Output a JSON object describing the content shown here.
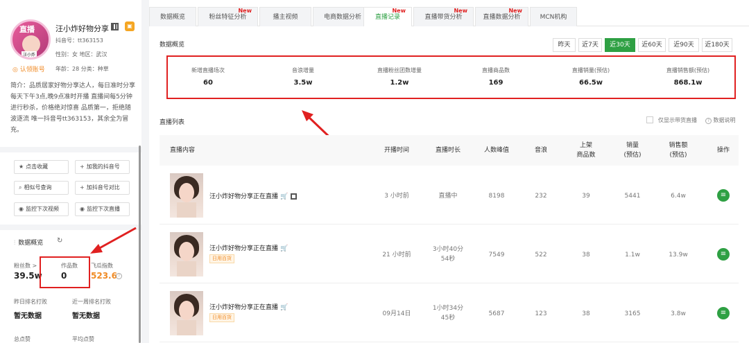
{
  "profile": {
    "avatar_tag": "直播",
    "avatar_sub": "汪小炸",
    "name": "汪小炸好物分享",
    "account": "抖音号：tt363153",
    "gender_region": "性别：女  地区：武汉",
    "verify": "认领账号",
    "age_category": "年龄：28  分类：种草",
    "intro": "简介：品质居家好物分享达人，每日准时分享 每天下午3点,晚9点准时开播 直播间每5分钟进行秒杀，价格绝对惊喜 品质第一，拒绝随波逐流 唯一抖音号tt363153，其余全为冒充。"
  },
  "actions": [
    {
      "icon": "★",
      "label": "点击收藏"
    },
    {
      "icon": "+",
      "label": "加我的抖音号"
    },
    {
      "icon": "⌕",
      "label": "相似号查询"
    },
    {
      "icon": "+",
      "label": "加抖音号对比"
    },
    {
      "icon": "◉",
      "label": "监控下次视频"
    },
    {
      "icon": "◉",
      "label": "监控下次直播"
    }
  ],
  "data_overview": {
    "title": "数据概览",
    "fans_label": "粉丝数 >",
    "fans_value": "39.5w",
    "works_label": "作品数",
    "works_value": "0",
    "feigua_label": "飞瓜指数",
    "feigua_value": "523.6",
    "yesterday_label": "昨日排名打败",
    "yesterday_value": "暂无数据",
    "week_label": "近一周排名打败",
    "week_value": "暂无数据",
    "total_likes_label": "总点赞",
    "avg_likes_label": "平均点赞"
  },
  "tabs": [
    {
      "label": "数据概览",
      "new": ""
    },
    {
      "label": "粉丝特征分析",
      "new": "New"
    },
    {
      "label": "播主视频",
      "new": ""
    },
    {
      "label": "电商数据分析",
      "new": ""
    },
    {
      "label": "直播记录",
      "new": "New"
    },
    {
      "label": "直播带货分析",
      "new": "New"
    },
    {
      "label": "直播数据分析",
      "new": "New"
    },
    {
      "label": "MCN机构",
      "new": ""
    }
  ],
  "overview": {
    "title": "数据概览",
    "ranges": [
      "昨天",
      "近7天",
      "近30天",
      "近60天",
      "近90天",
      "近180天"
    ],
    "active_range": "近30天",
    "metrics": [
      {
        "label": "新增直播场次",
        "value": "60"
      },
      {
        "label": "音浪增量",
        "value": "3.5w"
      },
      {
        "label": "直播粉丝团数增量",
        "value": "1.2w"
      },
      {
        "label": "直播商品数",
        "value": "169"
      },
      {
        "label": "直播销量(预估)",
        "value": "66.5w"
      },
      {
        "label": "直播销售额(预估)",
        "value": "868.1w"
      }
    ]
  },
  "live_list": {
    "title": "直播列表",
    "only_goods": "仅显示带货直播",
    "explain": "数据说明",
    "headers": [
      "直播内容",
      "开播时间",
      "直播时长",
      "人数峰值",
      "音浪",
      "上架\n商品数",
      "销量\n(预估)",
      "销售额\n(预估)",
      "操作"
    ],
    "rows": [
      {
        "title": "汪小炸好物分享正在直播",
        "tag": "",
        "start": "3 小时前",
        "duration": "直播中",
        "peak": "8198",
        "sound": "232",
        "goods": "39",
        "sales": "5441",
        "revenue": "6.4w"
      },
      {
        "title": "汪小炸好物分享正在直播",
        "tag": "日用百货",
        "start": "21 小时前",
        "duration": "3小时40分\n54秒",
        "peak": "7549",
        "sound": "522",
        "goods": "38",
        "sales": "1.1w",
        "revenue": "13.9w"
      },
      {
        "title": "汪小炸好物分享正在直播",
        "tag": "日用百货",
        "start": "09月14日",
        "duration": "1小时34分\n45秒",
        "peak": "5687",
        "sound": "123",
        "goods": "38",
        "sales": "3165",
        "revenue": "3.8w"
      }
    ]
  },
  "colors": {
    "accent": "#2ea043",
    "highlight": "#e02020",
    "warn": "#f08a24"
  }
}
